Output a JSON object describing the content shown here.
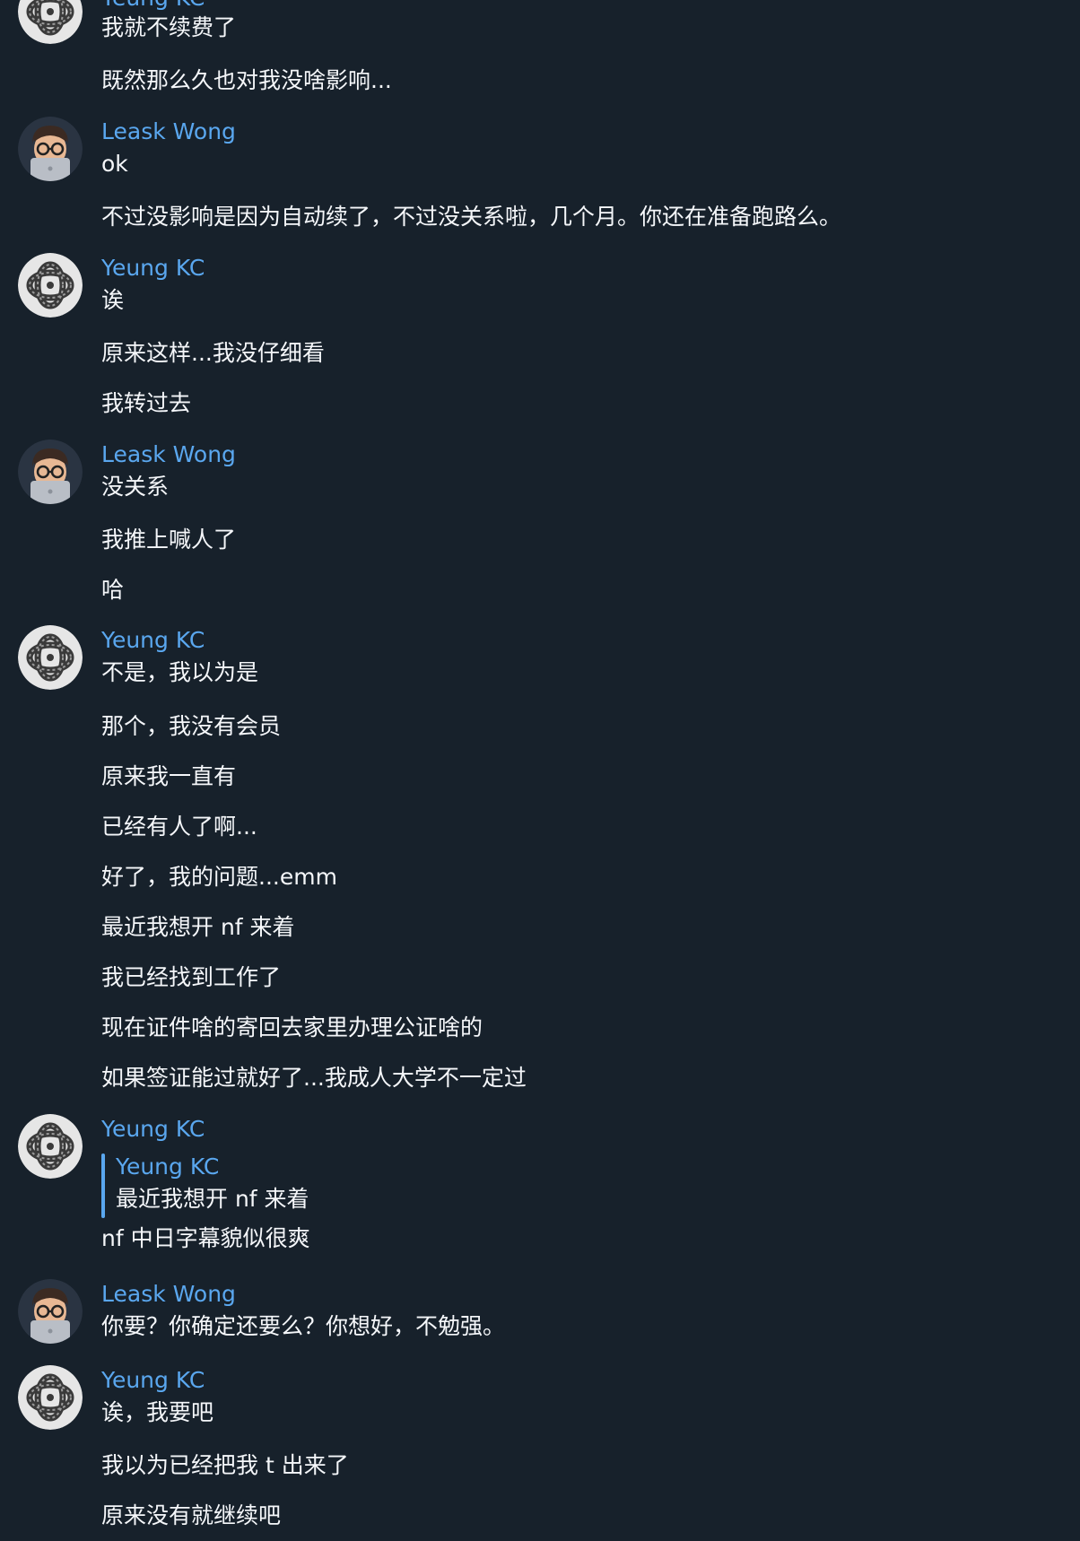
{
  "users": {
    "yeung": {
      "name": "Yeung KC",
      "avatar_icon": "ouroboros-serpent-icon"
    },
    "leask": {
      "name": "Leask Wong",
      "avatar_icon": "memoji-glasses-laptop-icon"
    }
  },
  "colors": {
    "background": "#17212b",
    "accent": "#5aa7ef",
    "text": "#f5f7fa"
  },
  "groups": [
    {
      "sender": "Yeung KC",
      "messages": [
        "我就不续费了",
        "既然那么久也对我没啥影响..."
      ]
    },
    {
      "sender": "Leask Wong",
      "messages": [
        "ok",
        "不过没影响是因为自动续了，不过没关系啦，几个月。你还在准备跑路么。"
      ]
    },
    {
      "sender": "Yeung KC",
      "messages": [
        "诶",
        "原来这样...我没仔细看",
        "我转过去"
      ]
    },
    {
      "sender": "Leask Wong",
      "messages": [
        "没关系",
        "我推上喊人了",
        "哈"
      ]
    },
    {
      "sender": "Yeung KC",
      "messages": [
        "不是，我以为是",
        "那个，我没有会员",
        "原来我一直有",
        "已经有人了啊...",
        "好了，我的问题...emm",
        "最近我想开 nf 来着",
        "我已经找到工作了",
        "现在证件啥的寄回去家里办理公证啥的",
        "如果签证能过就好了...我成人大学不一定过"
      ]
    },
    {
      "sender": "Yeung KC",
      "reply": {
        "name": "Yeung KC",
        "text": "最近我想开 nf 来着"
      },
      "messages": [
        "nf 中日字幕貌似很爽"
      ]
    },
    {
      "sender": "Leask Wong",
      "messages": [
        "你要？你确定还要么？你想好，不勉强。"
      ]
    },
    {
      "sender": "Yeung KC",
      "messages": [
        "诶，我要吧",
        "我以为已经把我 t 出来了",
        "原来没有就继续吧"
      ]
    }
  ]
}
